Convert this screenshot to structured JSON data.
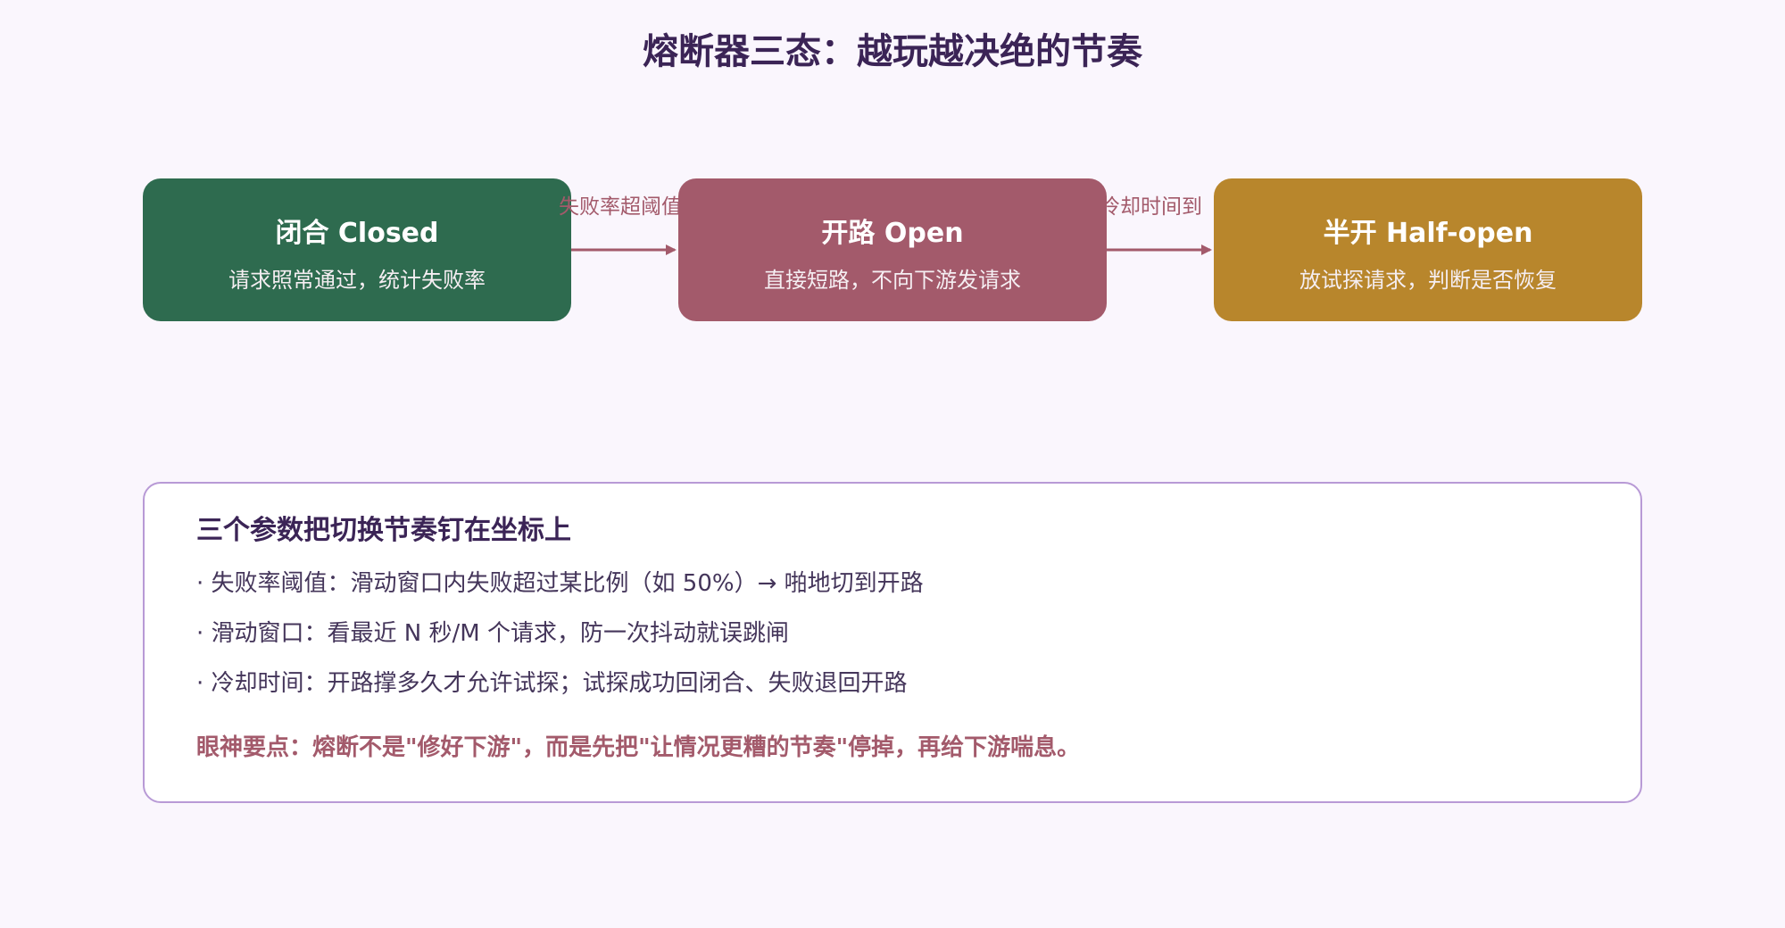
{
  "title": "熔断器三态：越玩越决绝的节奏",
  "colors": {
    "closed": "#2e6b4f",
    "open": "#a35a6b",
    "half_open": "#b8862c",
    "arrow": "#a35a6b",
    "title": "#3b2456",
    "panel_border": "#b89ad6",
    "tip": "#a35a6b"
  },
  "states": [
    {
      "name": "闭合 Closed",
      "desc": "请求照常通过，统计失败率"
    },
    {
      "name": "开路 Open",
      "desc": "直接短路，不向下游发请求"
    },
    {
      "name": "半开 Half-open",
      "desc": "放试探请求，判断是否恢复"
    }
  ],
  "transitions": [
    {
      "label": "失败率超阈值"
    },
    {
      "label": "冷却时间到"
    }
  ],
  "panel": {
    "title": "三个参数把切换节奏钉在坐标上",
    "params": [
      "· 失败率阈值：滑动窗口内失败超过某比例（如 50%）→ 啪地切到开路",
      "· 滑动窗口：看最近 N 秒/M 个请求，防一次抖动就误跳闸",
      "· 冷却时间：开路撑多久才允许试探；试探成功回闭合、失败退回开路"
    ],
    "tip": "眼神要点：熔断不是\"修好下游\"，而是先把\"让情况更糟的节奏\"停掉，再给下游喘息。"
  }
}
